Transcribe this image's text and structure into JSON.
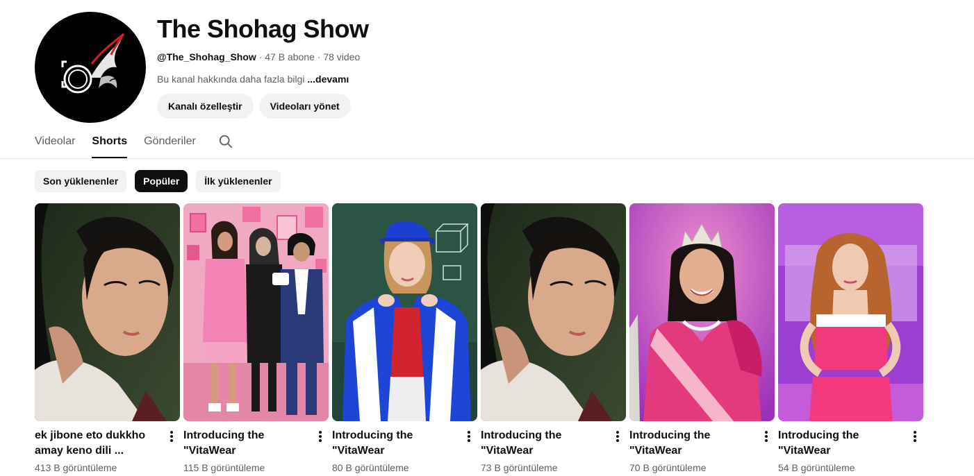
{
  "channel": {
    "name": "The Shohag Show",
    "handle": "@The_Shohag_Show",
    "sep1": " · ",
    "subscribers": "47 B abone",
    "sep2": " · ",
    "videos": "78 video",
    "about": "Bu kanal hakkında daha fazla bilgi ",
    "more": "...devamı",
    "customize_label": "Kanalı özelleştir",
    "manage_label": "Videoları yönet",
    "avatar_icon": "camera-phoenix-logo"
  },
  "tabs": [
    {
      "label": "Videolar"
    },
    {
      "label": "Shorts"
    },
    {
      "label": "Gönderiler"
    }
  ],
  "search_icon": "search-icon",
  "chips": [
    {
      "label": "Son yüklenenler"
    },
    {
      "label": "Popüler"
    },
    {
      "label": "İlk yüklenenler"
    }
  ],
  "shorts": [
    {
      "title": "ek jibone eto dukkho amay keno dili ...",
      "views": "413 B görüntüleme"
    },
    {
      "title": "Introducing the \"VitaWear SmartBand,\"...",
      "views": "115 B görüntüleme"
    },
    {
      "title": "Introducing the \"VitaWear SmartBand,\"...",
      "views": "80 B görüntüleme"
    },
    {
      "title": "Introducing the \"VitaWear SmartBand,\"...",
      "views": "73 B görüntüleme"
    },
    {
      "title": "Introducing the \"VitaWear SmartBand,\"...",
      "views": "70 B görüntüleme"
    },
    {
      "title": "Introducing the \"VitaWear SmartBand,\"...",
      "views": "54 B görüntüleme"
    }
  ],
  "colors": {
    "text": "#0f0f0f",
    "secondary": "#606060",
    "chip_bg": "#f2f2f2",
    "accent_red": "#d4202a"
  }
}
